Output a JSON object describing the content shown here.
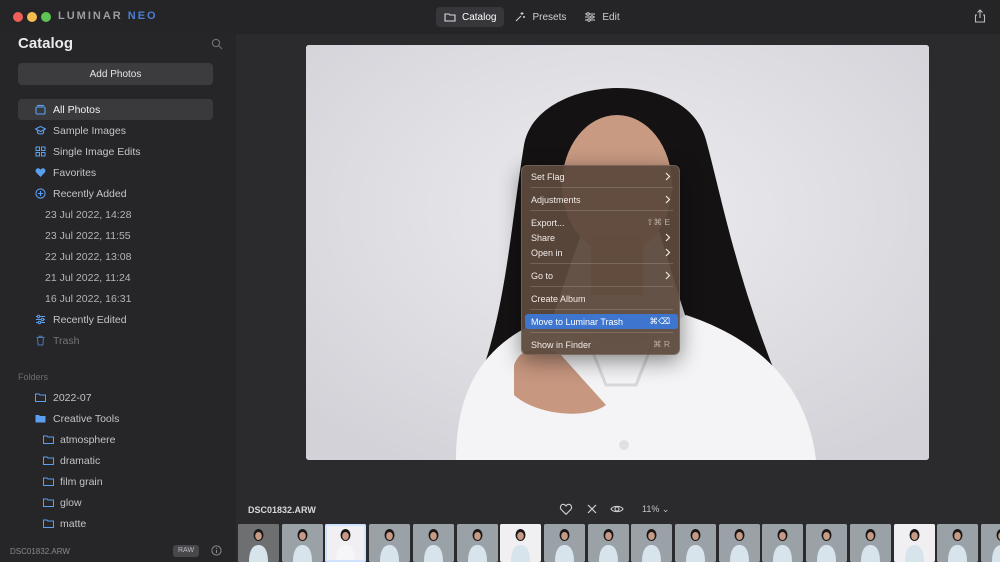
{
  "window": {
    "logo_text": "LUMINAR",
    "logo_suffix": "NEO",
    "nav": [
      {
        "label": "Catalog",
        "icon": "folder-icon",
        "active": true
      },
      {
        "label": "Presets",
        "icon": "sparkle-icon",
        "active": false
      },
      {
        "label": "Edit",
        "icon": "sliders-icon",
        "active": false
      }
    ]
  },
  "sidebar": {
    "title": "Catalog",
    "add_photos": "Add Photos",
    "items": [
      {
        "label": "All Photos",
        "icon": "photos-icon"
      },
      {
        "label": "Sample Images",
        "icon": "graduation-cap-icon"
      },
      {
        "label": "Single Image Edits",
        "icon": "grid-icon"
      },
      {
        "label": "Favorites",
        "icon": "heart-icon"
      },
      {
        "label": "Recently Added",
        "icon": "plus-circle-icon"
      },
      {
        "label": "23 Jul 2022, 14:28"
      },
      {
        "label": "23 Jul 2022, 11:55"
      },
      {
        "label": "22 Jul 2022, 13:08"
      },
      {
        "label": "21 Jul 2022, 11:24"
      },
      {
        "label": "16 Jul 2022, 16:31"
      },
      {
        "label": "Recently Edited",
        "icon": "sliders-icon"
      },
      {
        "label": "Trash",
        "icon": "trash-icon"
      }
    ],
    "folders_heading": "Folders",
    "folders": [
      {
        "label": "2022-07",
        "level": 1,
        "open": false
      },
      {
        "label": "Creative Tools",
        "level": 1,
        "open": true
      },
      {
        "label": "atmosphere",
        "level": 2,
        "open": false
      },
      {
        "label": "dramatic",
        "level": 2,
        "open": false
      },
      {
        "label": "film grain",
        "level": 2,
        "open": false
      },
      {
        "label": "glow",
        "level": 2,
        "open": false
      },
      {
        "label": "matte",
        "level": 2,
        "open": false
      }
    ],
    "footer": {
      "filename": "DSC01832.ARW",
      "badge": "RAW"
    }
  },
  "viewer": {
    "filename": "DSC01832.ARW",
    "zoom": "11%",
    "accent": "#3d75cf"
  },
  "context_menu": {
    "items": [
      {
        "label": "Set Flag",
        "submenu": true
      },
      {
        "label": "Adjustments",
        "submenu": true
      },
      {
        "label": "Export...",
        "shortcut": "⇧⌘ E"
      },
      {
        "label": "Share",
        "submenu": true
      },
      {
        "label": "Open in",
        "submenu": true
      },
      {
        "label": "Go to",
        "submenu": true
      },
      {
        "label": "Create Album"
      },
      {
        "label": "Move to Luminar Trash",
        "shortcut": "⌘⌫",
        "highlighted": true
      },
      {
        "label": "Show in Finder",
        "shortcut": "⌘ R"
      }
    ]
  },
  "filmstrip": {
    "thumbnail_count": 18,
    "selected_index": 2
  }
}
